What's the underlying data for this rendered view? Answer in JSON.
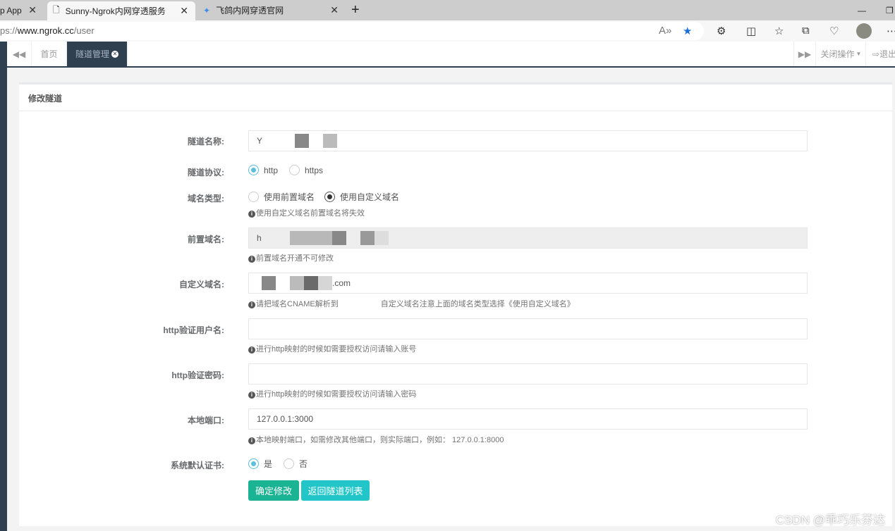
{
  "browser": {
    "tabs": [
      {
        "label": "p App"
      },
      {
        "label": "Sunny-Ngrok内网穿透服务"
      },
      {
        "label": "飞鸽内网穿透官网"
      }
    ],
    "url_prefix": "ps://",
    "url_host": "www.ngrok.cc",
    "url_path": "/user"
  },
  "nav": {
    "home": "首页",
    "active_tab": "隧道管理",
    "close_ops": "关闭操作",
    "logout": "退出"
  },
  "panel": {
    "title": "修改隧道"
  },
  "form": {
    "name_label": "隧道名称:",
    "name_value": "Y",
    "protocol_label": "隧道协议:",
    "protocol_options": [
      "http",
      "https"
    ],
    "protocol_selected": "http",
    "domain_type_label": "域名类型:",
    "domain_type_options": [
      "使用前置域名",
      "使用自定义域名"
    ],
    "domain_type_selected": "使用自定义域名",
    "domain_type_help": "使用自定义域名前置域名将失效",
    "prefix_label": "前置域名:",
    "prefix_value": "h",
    "prefix_help": "前置域名开通不可修改",
    "custom_label": "自定义域名:",
    "custom_value": ".com",
    "custom_help_a": "请把域名CNAME解析到",
    "custom_help_b": "自定义域名注意上面的域名类型选择《使用自定义域名》",
    "user_label": "http验证用户名:",
    "user_value": "",
    "user_help": "进行http映射的时候如需要授权访问请输入账号",
    "pw_label": "http验证密码:",
    "pw_value": "",
    "pw_help": "进行http映射的时候如需要授权访问请输入密码",
    "port_label": "本地端口:",
    "port_value": "127.0.0.1:3000",
    "port_help": "本地映射端口，如需修改其他端口，则实际端口，例如： 127.0.0.1:8000",
    "cert_label": "系统默认证书:",
    "cert_options": [
      "是",
      "否"
    ],
    "cert_selected": "是",
    "submit": "确定修改",
    "back": "返回隧道列表"
  },
  "watermark": "CSDN @乖巧乐芬达",
  "colors": {
    "primary": "#1ab394",
    "info": "#23c6c8",
    "nav_dark": "#2f4050",
    "radio": "#5bc0de"
  }
}
